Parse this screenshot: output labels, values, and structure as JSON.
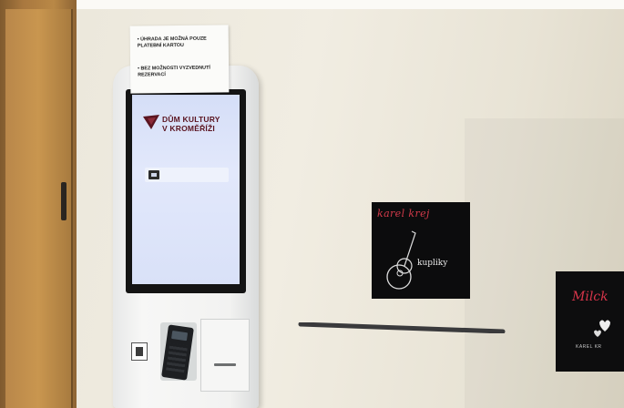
{
  "notice": {
    "line1": "• ÚHRADA JE MOŽNÁ POUZE PLATEBNÍ KARTOU",
    "line2": "• BEZ MOŽNOSTI VYZVEDNUTÍ REZERVACÍ"
  },
  "kiosk": {
    "logo_line1": "DŮM KULTURY",
    "logo_line2": "V KROMĚŘÍŽI",
    "brand_color": "#5a1420",
    "button_icon": "ticket-icon"
  },
  "posters": {
    "poster1_title": "karel krej",
    "poster1_subtitle": "kupliky",
    "poster2_title": "Milck",
    "poster2_subtitle": "KAREL KR"
  }
}
